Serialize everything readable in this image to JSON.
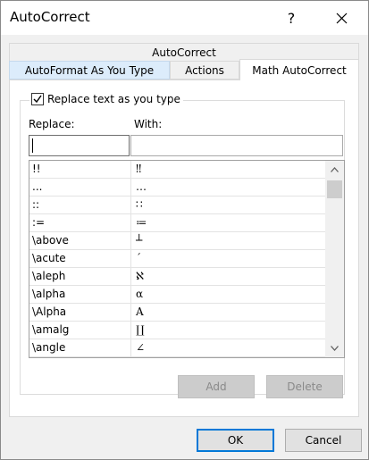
{
  "window": {
    "title": "AutoCorrect"
  },
  "icons": {
    "help": "help-icon",
    "close": "close-icon"
  },
  "tabs": {
    "top": "AutoCorrect",
    "autoformat": "AutoFormat As You Type",
    "actions": "Actions",
    "math": "Math AutoCorrect"
  },
  "options": {
    "replace_text_label": "Replace text as you type",
    "replace_text_checked": true
  },
  "fields": {
    "replace_label": "Replace:",
    "with_label": "With:",
    "replace_value": "",
    "with_value": ""
  },
  "list": {
    "rows": [
      {
        "replace": "!!",
        "with": "‼"
      },
      {
        "replace": "...",
        "with": "…"
      },
      {
        "replace": "::",
        "with": "∷"
      },
      {
        "replace": ":=",
        "with": "≔"
      },
      {
        "replace": "\\above",
        "with": "┴"
      },
      {
        "replace": "\\acute",
        "with": "´"
      },
      {
        "replace": "\\aleph",
        "with": "ℵ"
      },
      {
        "replace": "\\alpha",
        "with": "α"
      },
      {
        "replace": "\\Alpha",
        "with": "Α"
      },
      {
        "replace": "\\amalg",
        "with": "∐"
      },
      {
        "replace": "\\angle",
        "with": "∠"
      }
    ]
  },
  "buttons": {
    "add": "Add",
    "delete": "Delete",
    "ok": "OK",
    "cancel": "Cancel"
  },
  "colors": {
    "accent": "#0078d7",
    "selected_tab_bg": "#dcecfb",
    "disabled_button_bg": "#cccccc"
  }
}
